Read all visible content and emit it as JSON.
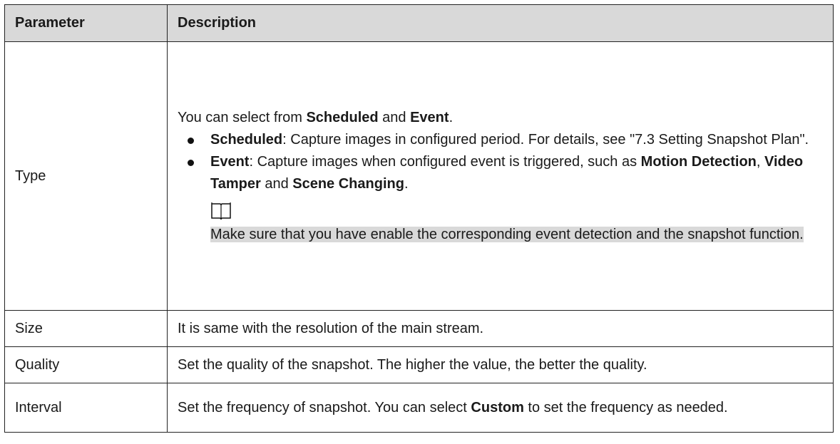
{
  "headers": {
    "parameter": "Parameter",
    "description": "Description"
  },
  "type": {
    "name": "Type",
    "intro": [
      "You can select from ",
      "Scheduled",
      " and ",
      "Event",
      "."
    ],
    "bullet1": [
      "Scheduled",
      ": Capture images in configured period. For details, see \"7.3 Setting Snapshot Plan\"."
    ],
    "bullet2": [
      "Event",
      ": Capture images when configured event is triggered, such as ",
      "Motion Detection",
      ", ",
      "Video Tamper",
      " and ",
      "Scene Changing",
      "."
    ],
    "note_icon": "book-icon",
    "note": "Make sure that you have enable the corresponding event detection and the snapshot function."
  },
  "size": {
    "name": "Size",
    "desc": "It is same with the resolution of the main stream."
  },
  "quality": {
    "name": "Quality",
    "desc": "Set the quality of the snapshot. The higher the value, the better the quality."
  },
  "interval": {
    "name": "Interval",
    "desc": [
      "Set the frequency of snapshot. You can select ",
      "Custom",
      " to set the frequency as needed."
    ]
  },
  "colors": {
    "header_bg": "#d9d9d9",
    "note_bg": "#d9d9d9"
  }
}
